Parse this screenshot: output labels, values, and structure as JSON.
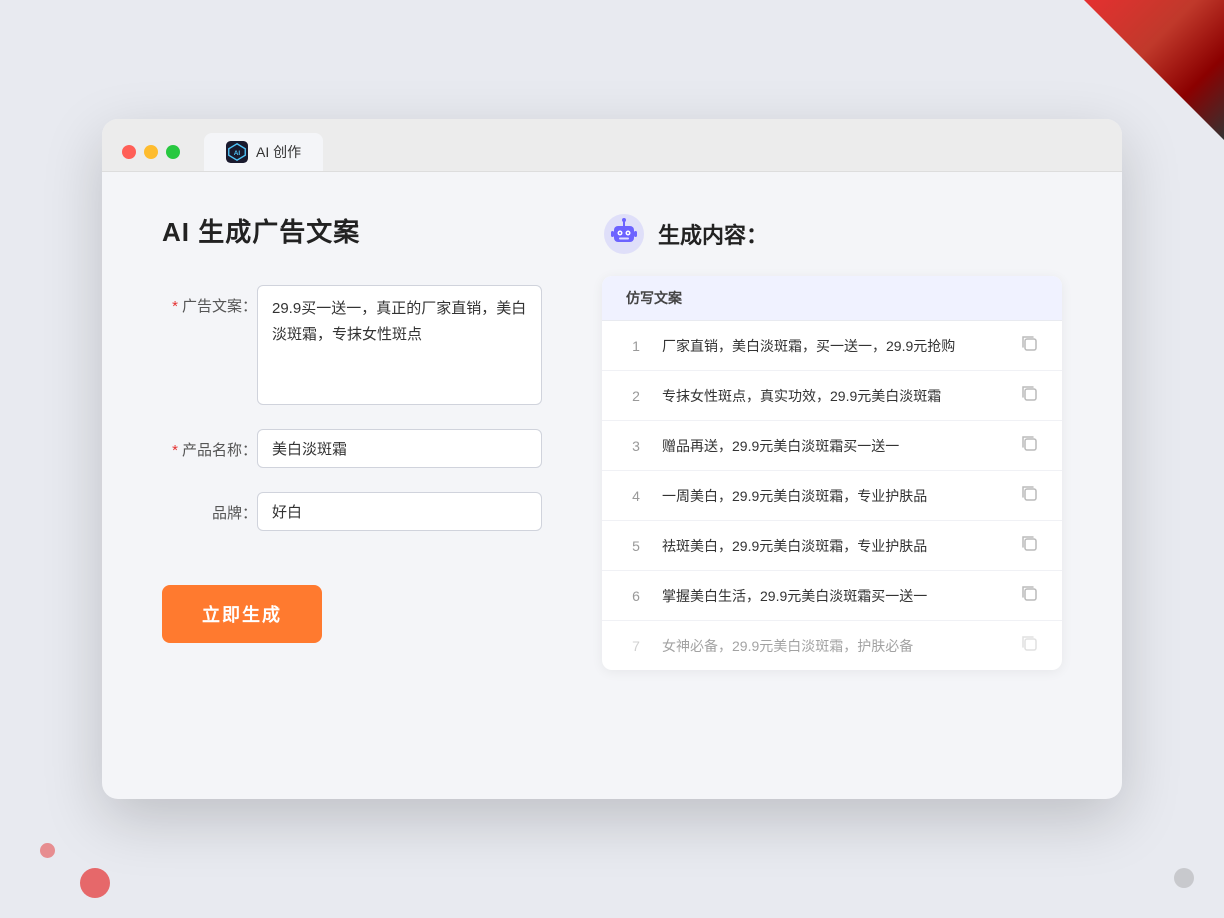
{
  "decorations": {
    "corner_tr": "top-right red corner",
    "corner_bl": "bottom-left red dot",
    "corner_br": "bottom-right grey dot"
  },
  "browser": {
    "tab_label": "AI 创作",
    "traffic_lights": [
      "red",
      "yellow",
      "green"
    ]
  },
  "left_panel": {
    "page_title": "AI 生成广告文案",
    "form": {
      "ad_copy_label": "广告文案：",
      "ad_copy_required": "*",
      "ad_copy_value": "29.9买一送一，真正的厂家直销，美白淡斑霜，专抹女性斑点",
      "product_name_label": "产品名称：",
      "product_name_required": "*",
      "product_name_value": "美白淡斑霜",
      "brand_label": "品牌：",
      "brand_value": "好白"
    },
    "generate_button": "立即生成"
  },
  "right_panel": {
    "result_title": "生成内容：",
    "table_header": "仿写文案",
    "results": [
      {
        "num": "1",
        "text": "厂家直销，美白淡斑霜，买一送一，29.9元抢购",
        "faded": false
      },
      {
        "num": "2",
        "text": "专抹女性斑点，真实功效，29.9元美白淡斑霜",
        "faded": false
      },
      {
        "num": "3",
        "text": "赠品再送，29.9元美白淡斑霜买一送一",
        "faded": false
      },
      {
        "num": "4",
        "text": "一周美白，29.9元美白淡斑霜，专业护肤品",
        "faded": false
      },
      {
        "num": "5",
        "text": "祛斑美白，29.9元美白淡斑霜，专业护肤品",
        "faded": false
      },
      {
        "num": "6",
        "text": "掌握美白生活，29.9元美白淡斑霜买一送一",
        "faded": false
      },
      {
        "num": "7",
        "text": "女神必备，29.9元美白淡斑霜，护肤必备",
        "faded": true
      }
    ]
  },
  "colors": {
    "orange": "#ff7a2f",
    "red": "#e53030",
    "blue_light": "#f0f2ff",
    "bg": "#f4f5f8"
  }
}
